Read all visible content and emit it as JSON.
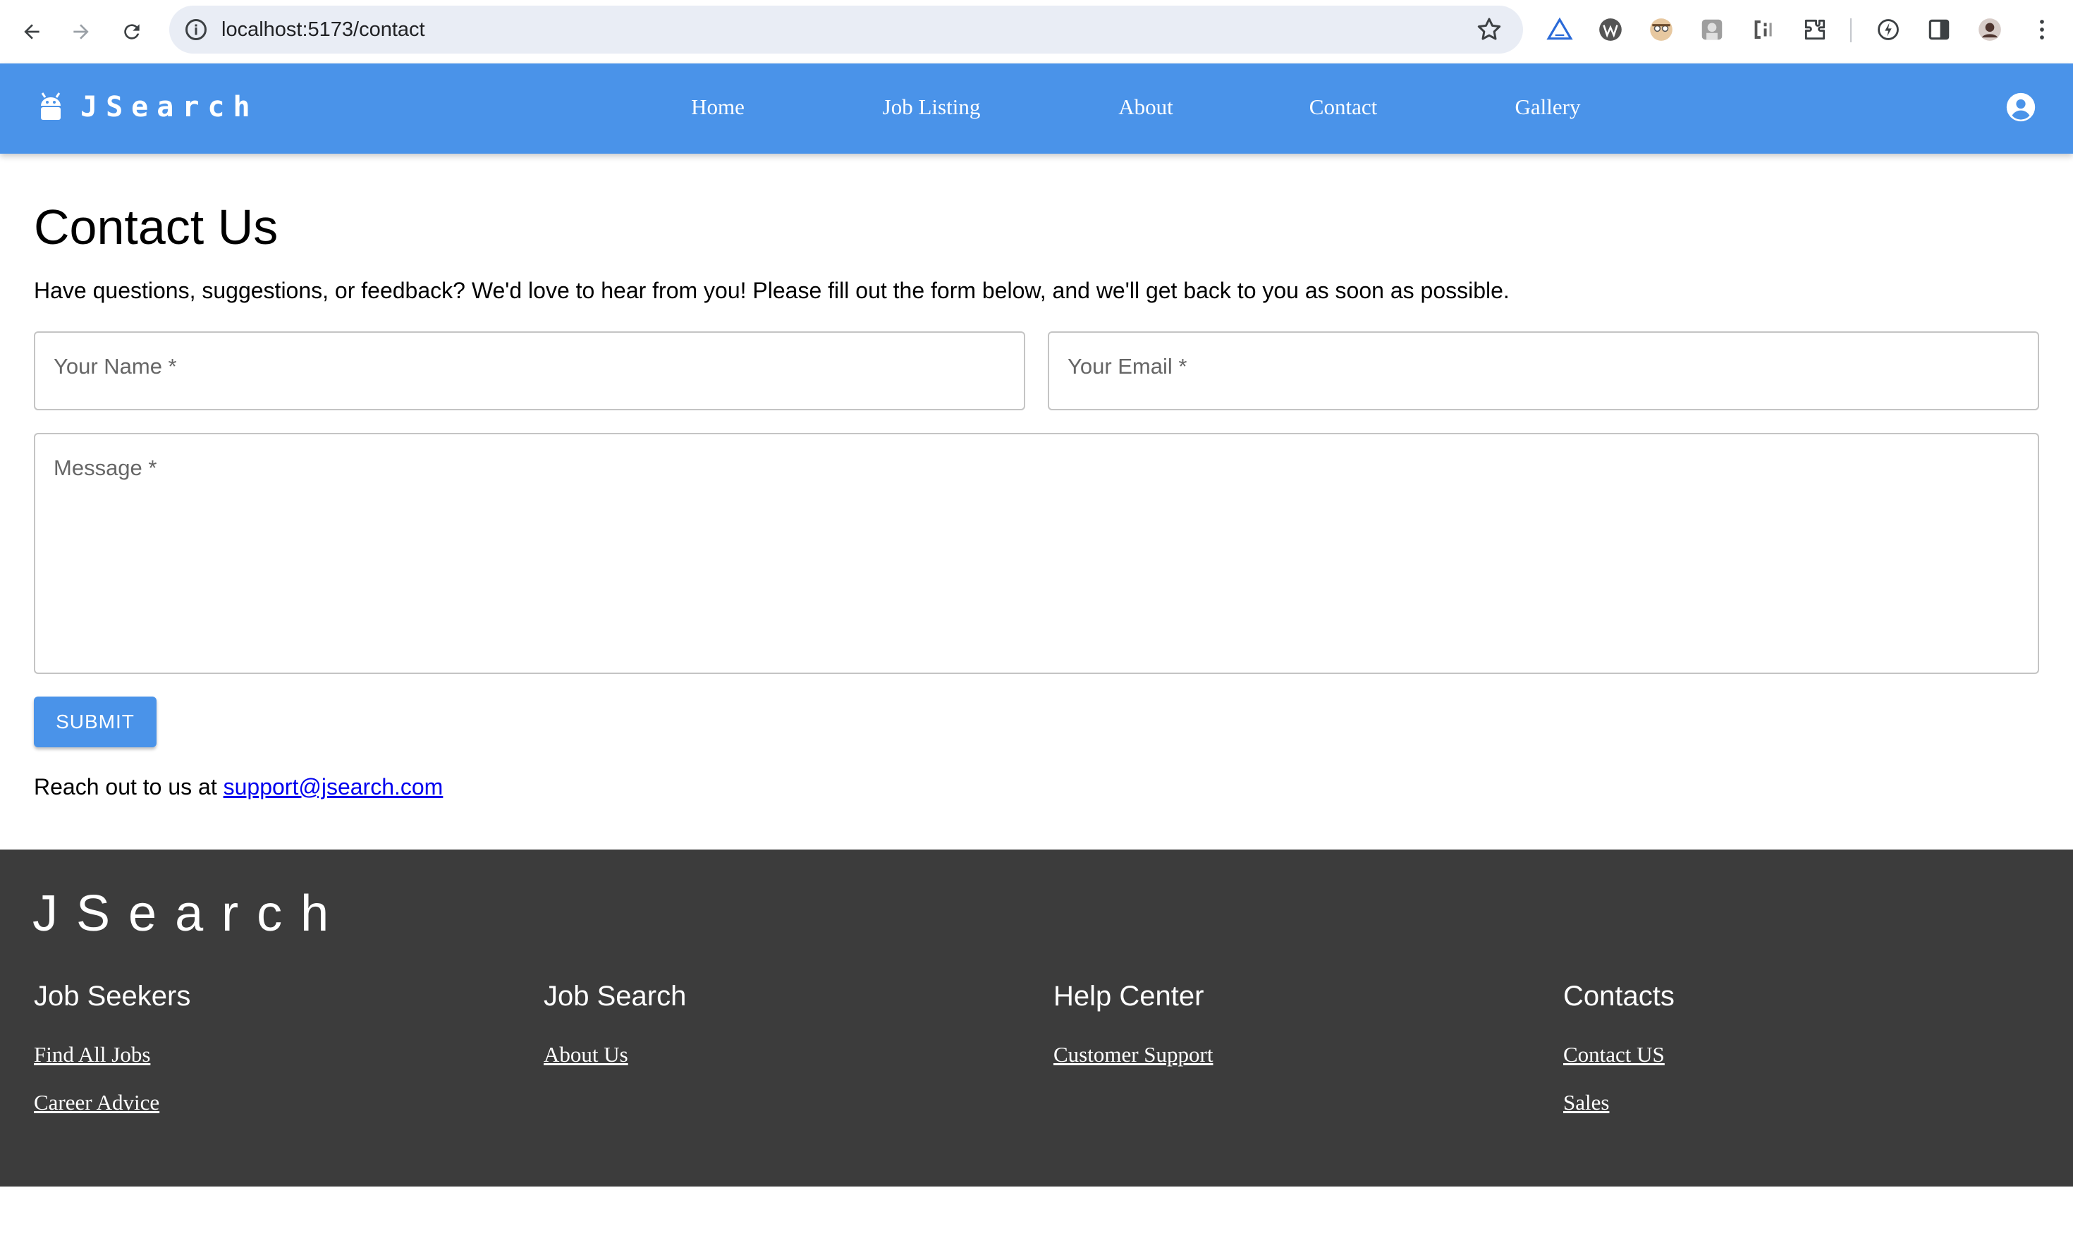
{
  "browser": {
    "url": "localhost:5173/contact",
    "extensions": [
      "triangle-extension-icon",
      "wordpress-icon",
      "avatar-extension-icon",
      "portrait-extension-icon",
      "css-extension-icon",
      "puzzle-icon",
      "refresh-lightning-icon",
      "sidebar-icon",
      "profile-avatar-icon",
      "more-vert-icon"
    ]
  },
  "header": {
    "brand": "JSearch",
    "nav": [
      {
        "label": "Home"
      },
      {
        "label": "Job Listing"
      },
      {
        "label": "About"
      },
      {
        "label": "Contact"
      },
      {
        "label": "Gallery"
      }
    ]
  },
  "main": {
    "title": "Contact Us",
    "intro": "Have questions, suggestions, or feedback? We'd love to hear from you! Please fill out the form below, and we'll get back to you as soon as possible.",
    "form": {
      "name_placeholder": "Your Name *",
      "email_placeholder": "Your Email *",
      "message_placeholder": "Message *",
      "submit_label": "SUBMIT"
    },
    "reach_text": "Reach out to us at ",
    "email": "support@jsearch.com"
  },
  "footer": {
    "brand": "JSearch",
    "columns": [
      {
        "title": "Job Seekers",
        "links": [
          "Find All Jobs",
          "Career Advice"
        ]
      },
      {
        "title": "Job Search",
        "links": [
          "About Us"
        ]
      },
      {
        "title": "Help Center",
        "links": [
          "Customer Support"
        ]
      },
      {
        "title": "Contacts",
        "links": [
          "Contact US",
          "Sales"
        ]
      }
    ]
  },
  "colors": {
    "header_bg": "#4a93e9",
    "footer_bg": "#3c3c3c",
    "link": "#0000ee"
  }
}
